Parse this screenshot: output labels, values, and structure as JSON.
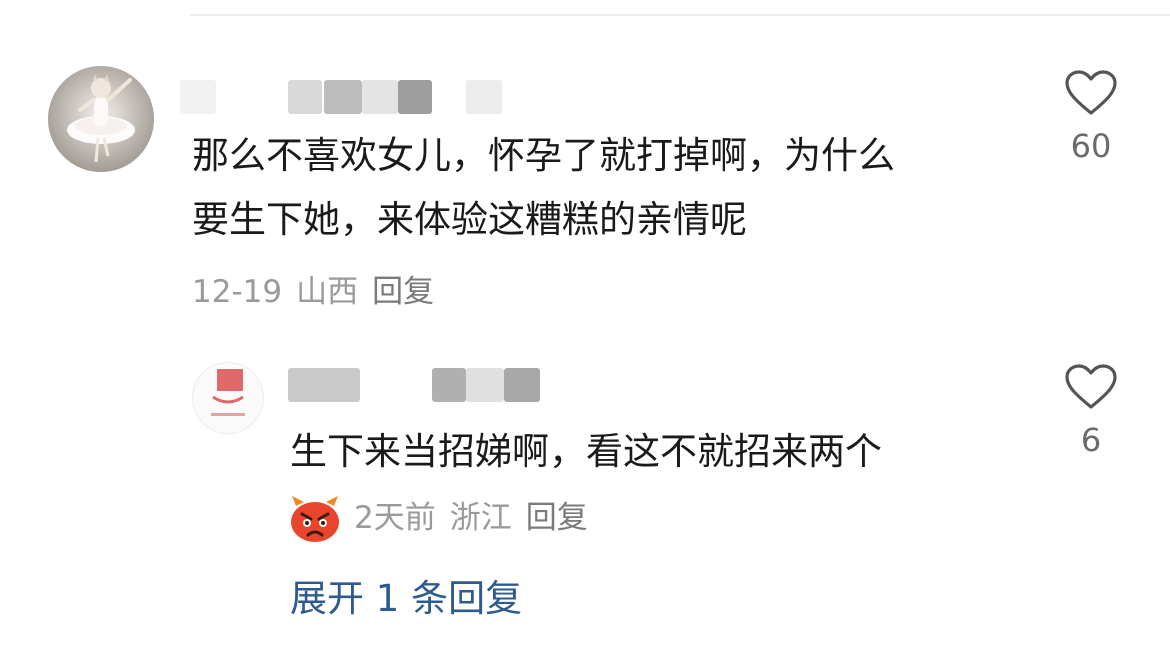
{
  "colors": {
    "text": "#1a1a1a",
    "meta": "#9a9a9a",
    "link": "#2f5a8e",
    "like_icon": "#555555"
  },
  "comment": {
    "avatar_icon": "ballerina-cat-avatar",
    "text_line1": "那么不喜欢女儿，怀孕了就打掉啊，为什么",
    "text_line2": "要生下她，来体验这糟糕的亲情呢",
    "date": "12-19",
    "location": "山西",
    "reply_label": "回复",
    "like_icon": "heart-outline-icon",
    "like_count": "60"
  },
  "reply": {
    "avatar_icon": "red-logo-avatar",
    "text": "生下来当招娣啊，看这不就招来两个",
    "badge_icon": "angry-red-emoji-icon",
    "date": "2天前",
    "location": "浙江",
    "reply_label": "回复",
    "like_icon": "heart-outline-icon",
    "like_count": "6"
  },
  "expand_label": "展开 1 条回复"
}
